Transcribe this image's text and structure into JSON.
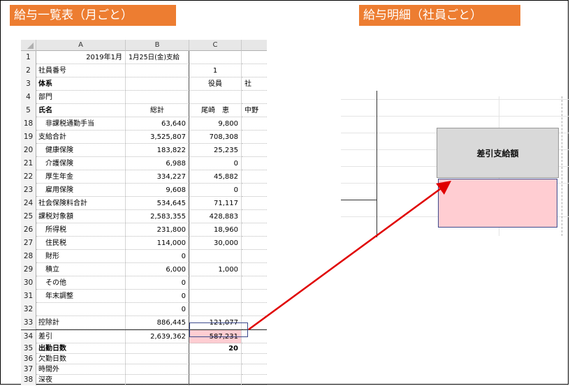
{
  "titles": {
    "monthly": "給与一覧表（月ごと）",
    "employee": "給与明細（社員ごと）"
  },
  "sheet": {
    "columns": [
      "A",
      "B",
      "C"
    ],
    "rows": [
      {
        "n": "1",
        "a": "",
        "b": "",
        "c": "",
        "d": ""
      },
      {
        "n": "2",
        "a": "社員番号",
        "b": "",
        "c": "1",
        "d": ""
      },
      {
        "n": "3",
        "a": "体系",
        "b": "",
        "c": "役員",
        "d": "社"
      },
      {
        "n": "4",
        "a": "部門",
        "b": "",
        "c": "",
        "d": ""
      },
      {
        "n": "5",
        "a": "氏名",
        "b": "総計",
        "c": "尾崎　恵",
        "d": "中野"
      },
      {
        "n": "18",
        "a": "　非課税通勤手当",
        "b": "63,640",
        "c": "9,800",
        "d": ""
      },
      {
        "n": "19",
        "a": "支給合計",
        "b": "3,525,807",
        "c": "708,308",
        "d": ""
      },
      {
        "n": "20",
        "a": "　健康保険",
        "b": "183,822",
        "c": "25,235",
        "d": ""
      },
      {
        "n": "21",
        "a": "　介護保険",
        "b": "6,988",
        "c": "0",
        "d": ""
      },
      {
        "n": "22",
        "a": "　厚生年金",
        "b": "334,227",
        "c": "45,882",
        "d": ""
      },
      {
        "n": "23",
        "a": "　雇用保険",
        "b": "9,608",
        "c": "0",
        "d": ""
      },
      {
        "n": "24",
        "a": "社会保険料合計",
        "b": "534,645",
        "c": "71,117",
        "d": ""
      },
      {
        "n": "25",
        "a": "課税対象額",
        "b": "2,583,355",
        "c": "428,883",
        "d": ""
      },
      {
        "n": "26",
        "a": "　所得税",
        "b": "231,800",
        "c": "18,960",
        "d": ""
      },
      {
        "n": "27",
        "a": "　住民税",
        "b": "114,000",
        "c": "30,000",
        "d": ""
      },
      {
        "n": "28",
        "a": "　財形",
        "b": "0",
        "c": "",
        "d": ""
      },
      {
        "n": "29",
        "a": "　積立",
        "b": "6,000",
        "c": "1,000",
        "d": ""
      },
      {
        "n": "30",
        "a": "　その他",
        "b": "0",
        "c": "",
        "d": ""
      },
      {
        "n": "31",
        "a": "　年末調整",
        "b": "0",
        "c": "",
        "d": ""
      },
      {
        "n": "32",
        "a": "",
        "b": "0",
        "c": "",
        "d": ""
      },
      {
        "n": "33",
        "a": "控除計",
        "b": "886,445",
        "c": "121,077",
        "d": ""
      },
      {
        "n": "34",
        "a": "差引",
        "b": "2,639,362",
        "c": "587,231",
        "d": ""
      },
      {
        "n": "35",
        "a": "出勤日数",
        "b": "",
        "c": "20",
        "d": ""
      },
      {
        "n": "36",
        "a": "欠勤日数",
        "b": "",
        "c": "",
        "d": ""
      },
      {
        "n": "37",
        "a": "時間外",
        "b": "",
        "c": "",
        "d": ""
      },
      {
        "n": "38",
        "a": "深夜",
        "b": "",
        "c": "",
        "d": ""
      }
    ],
    "row1_date": "2019年1月",
    "row1_payday": "1月25日(金)支給"
  },
  "payslip": {
    "label": "差引支給額"
  },
  "colors": {
    "title_bg": "#ed7d31",
    "highlight": "#ffcdd2",
    "arrow": "#e00000"
  }
}
